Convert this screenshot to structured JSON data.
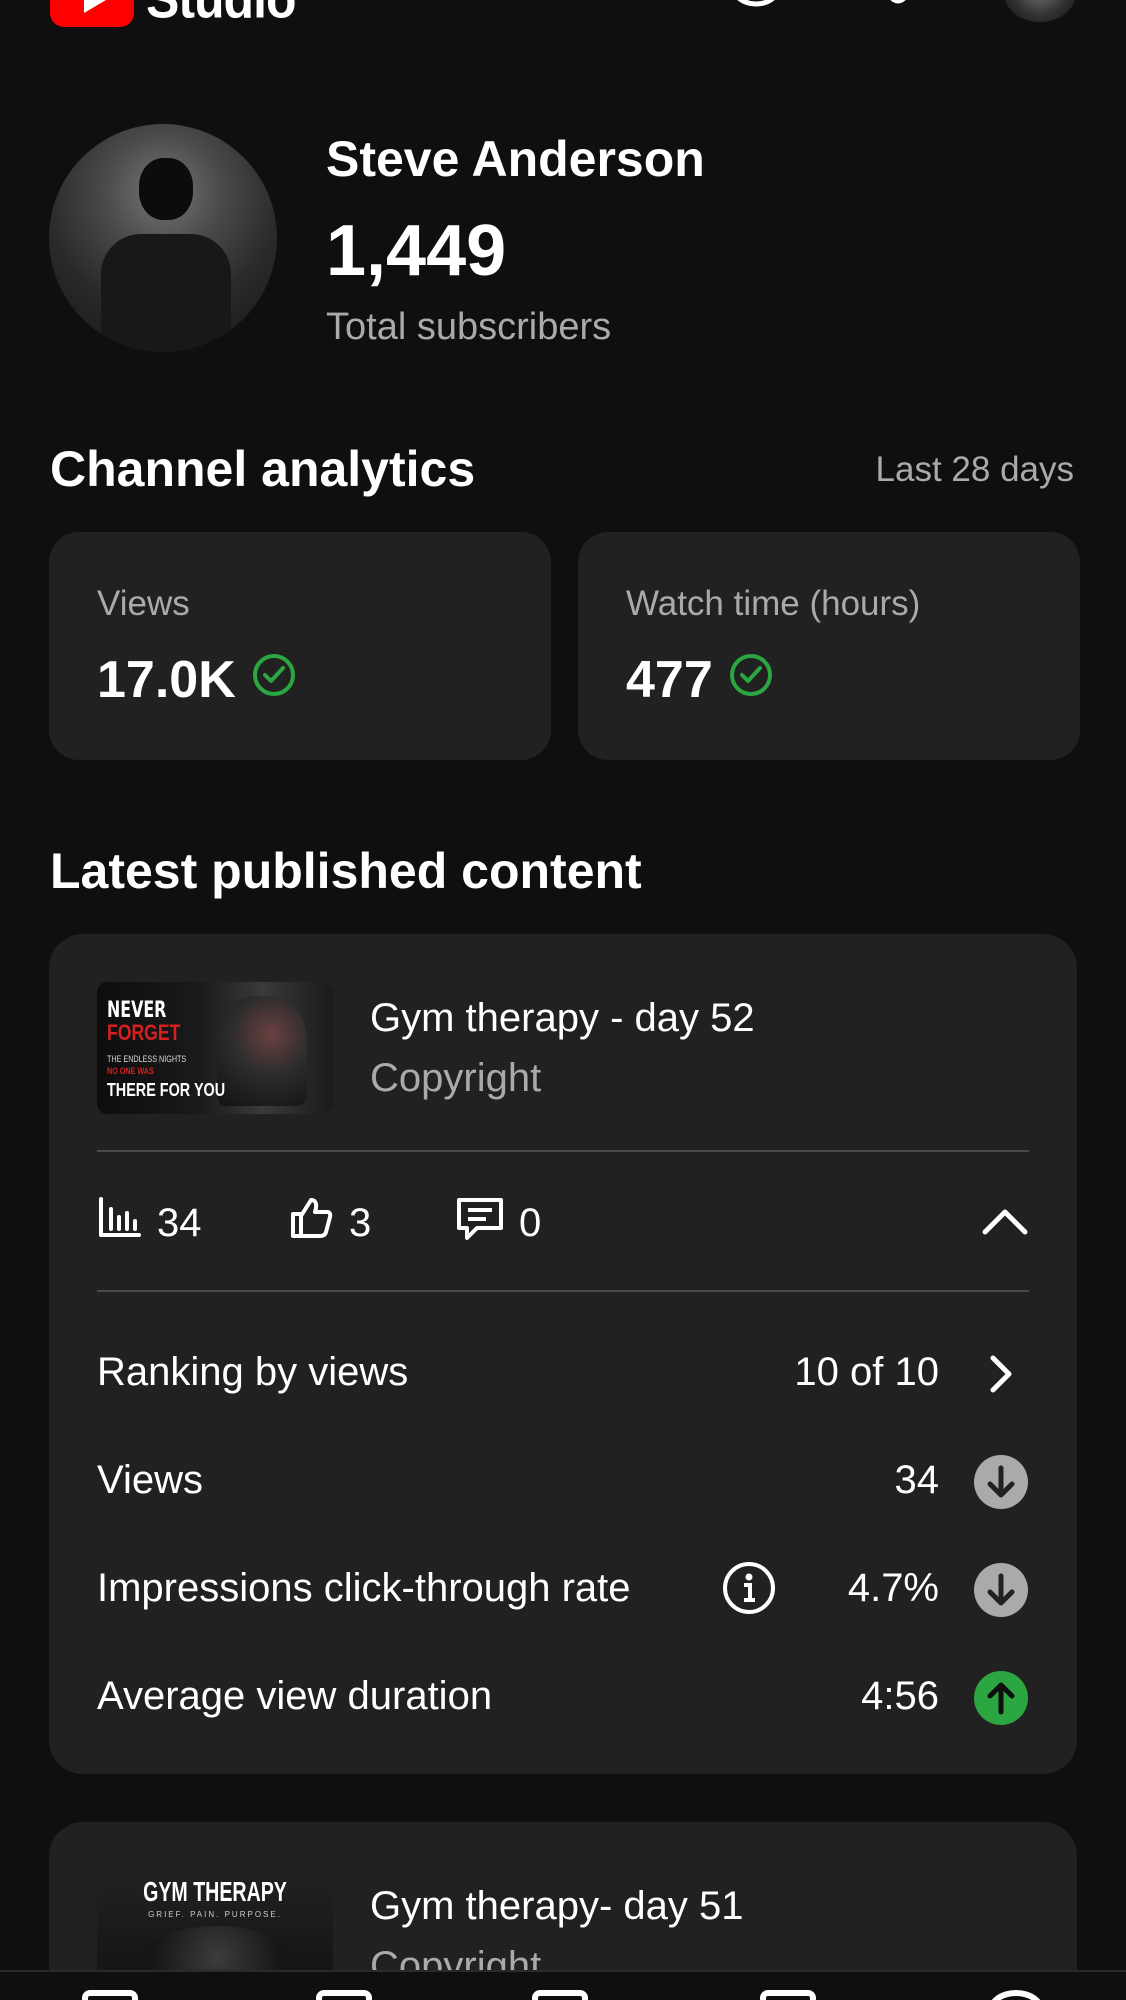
{
  "header": {
    "app_name": "Studio",
    "icons": [
      "youtube-logo",
      "create-icon",
      "bell-icon",
      "account-avatar"
    ]
  },
  "channel": {
    "name": "Steve Anderson",
    "subscribers": "1,449",
    "subscribers_label": "Total subscribers"
  },
  "analytics": {
    "title": "Channel analytics",
    "range": "Last 28 days",
    "cards": [
      {
        "label": "Views",
        "value": "17.0K",
        "status_icon": "check-circle-icon"
      },
      {
        "label": "Watch time (hours)",
        "value": "477",
        "status_icon": "check-circle-icon"
      }
    ]
  },
  "latest": {
    "title": "Latest published content",
    "video": {
      "title": "Gym therapy - day 52",
      "subtitle": "Copyright",
      "thumbnail_text": {
        "line1": "NEVER",
        "line2": "FORGET",
        "line3": "THE ENDLESS NIGHTS",
        "line4": "NO ONE WAS",
        "line5": "THERE FOR YOU"
      },
      "metrics": {
        "views": "34",
        "likes": "3",
        "comments": "0"
      },
      "details": [
        {
          "label": "Ranking by views",
          "value": "10 of 10",
          "icon": "chevron-right-icon"
        },
        {
          "label": "Views",
          "value": "34",
          "icon": "arrow-down-icon"
        },
        {
          "label": "Impressions click-through rate",
          "value": "4.7%",
          "icon": "arrow-down-icon",
          "info": "info-icon"
        },
        {
          "label": "Average view duration",
          "value": "4:56",
          "icon": "arrow-up-icon"
        }
      ]
    },
    "video2": {
      "title": "Gym therapy- day 51",
      "subtitle": "Copyright",
      "thumbnail_text": {
        "line1": "GYM THERAPY",
        "line2": "GRIEF. PAIN. PURPOSE."
      }
    }
  },
  "colors": {
    "background": "#0f0f0f",
    "card": "#212121",
    "secondary_text": "#aaaaaa",
    "accent_green": "#2ba640",
    "brand_red": "#ff0000",
    "trend_down_gray": "#aaaaaa"
  }
}
